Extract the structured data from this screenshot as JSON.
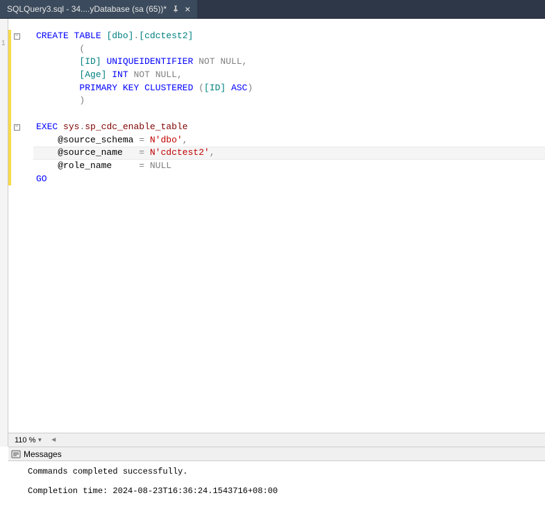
{
  "tab": {
    "title": "SQLQuery3.sql - 34....yDatabase (sa (65))*"
  },
  "ruler": {
    "mark": "1"
  },
  "code": {
    "lines": [
      {
        "fold": true,
        "tokens": [
          {
            "t": "CREATE",
            "c": "kw-blue"
          },
          {
            "t": " ",
            "c": "black"
          },
          {
            "t": "TABLE",
            "c": "kw-blue"
          },
          {
            "t": " ",
            "c": "black"
          },
          {
            "t": "[dbo]",
            "c": "teal"
          },
          {
            "t": ".",
            "c": "gray"
          },
          {
            "t": "[cdctest2]",
            "c": "teal"
          }
        ]
      },
      {
        "tokens": [
          {
            "t": "        ",
            "c": "black"
          },
          {
            "t": "(",
            "c": "gray"
          }
        ]
      },
      {
        "tokens": [
          {
            "t": "        ",
            "c": "black"
          },
          {
            "t": "[ID]",
            "c": "teal"
          },
          {
            "t": " ",
            "c": "black"
          },
          {
            "t": "UNIQUEIDENTIFIER",
            "c": "kw-blue"
          },
          {
            "t": " ",
            "c": "black"
          },
          {
            "t": "NOT",
            "c": "gray"
          },
          {
            "t": " ",
            "c": "black"
          },
          {
            "t": "NULL",
            "c": "gray"
          },
          {
            "t": ",",
            "c": "gray"
          }
        ]
      },
      {
        "tokens": [
          {
            "t": "        ",
            "c": "black"
          },
          {
            "t": "[Age]",
            "c": "teal"
          },
          {
            "t": " ",
            "c": "black"
          },
          {
            "t": "INT",
            "c": "kw-blue"
          },
          {
            "t": " ",
            "c": "black"
          },
          {
            "t": "NOT",
            "c": "gray"
          },
          {
            "t": " ",
            "c": "black"
          },
          {
            "t": "NULL",
            "c": "gray"
          },
          {
            "t": ",",
            "c": "gray"
          }
        ]
      },
      {
        "tokens": [
          {
            "t": "        ",
            "c": "black"
          },
          {
            "t": "PRIMARY",
            "c": "kw-blue"
          },
          {
            "t": " ",
            "c": "black"
          },
          {
            "t": "KEY",
            "c": "kw-blue"
          },
          {
            "t": " ",
            "c": "black"
          },
          {
            "t": "CLUSTERED",
            "c": "kw-blue"
          },
          {
            "t": " ",
            "c": "black"
          },
          {
            "t": "(",
            "c": "gray"
          },
          {
            "t": "[ID]",
            "c": "teal"
          },
          {
            "t": " ",
            "c": "black"
          },
          {
            "t": "ASC",
            "c": "kw-blue"
          },
          {
            "t": ")",
            "c": "gray"
          }
        ]
      },
      {
        "tokens": [
          {
            "t": "        ",
            "c": "black"
          },
          {
            "t": ")",
            "c": "gray"
          }
        ]
      },
      {
        "tokens": []
      },
      {
        "fold": true,
        "tokens": [
          {
            "t": "EXEC",
            "c": "kw-blue"
          },
          {
            "t": " ",
            "c": "black"
          },
          {
            "t": "sys",
            "c": "darkred"
          },
          {
            "t": ".",
            "c": "gray"
          },
          {
            "t": "sp_cdc_enable_table",
            "c": "darkred"
          }
        ]
      },
      {
        "tokens": [
          {
            "t": "    @source_schema ",
            "c": "black"
          },
          {
            "t": "=",
            "c": "gray"
          },
          {
            "t": " ",
            "c": "black"
          },
          {
            "t": "N'dbo'",
            "c": "red-str"
          },
          {
            "t": ",",
            "c": "gray"
          }
        ]
      },
      {
        "highlighted": true,
        "tokens": [
          {
            "t": "    @source_name   ",
            "c": "black"
          },
          {
            "t": "=",
            "c": "gray"
          },
          {
            "t": " ",
            "c": "black"
          },
          {
            "t": "N'cdctest2'",
            "c": "red-str"
          },
          {
            "t": ",",
            "c": "gray"
          }
        ]
      },
      {
        "tokens": [
          {
            "t": "    @role_name     ",
            "c": "black"
          },
          {
            "t": "=",
            "c": "gray"
          },
          {
            "t": " ",
            "c": "black"
          },
          {
            "t": "NULL",
            "c": "gray"
          }
        ]
      },
      {
        "tokens": [
          {
            "t": "GO",
            "c": "kw-blue"
          }
        ]
      }
    ]
  },
  "zoom": {
    "value": "110 %"
  },
  "messages": {
    "tab_label": "Messages",
    "line1": "Commands completed successfully.",
    "line2": "Completion time: 2024-08-23T16:36:24.1543716+08:00"
  }
}
